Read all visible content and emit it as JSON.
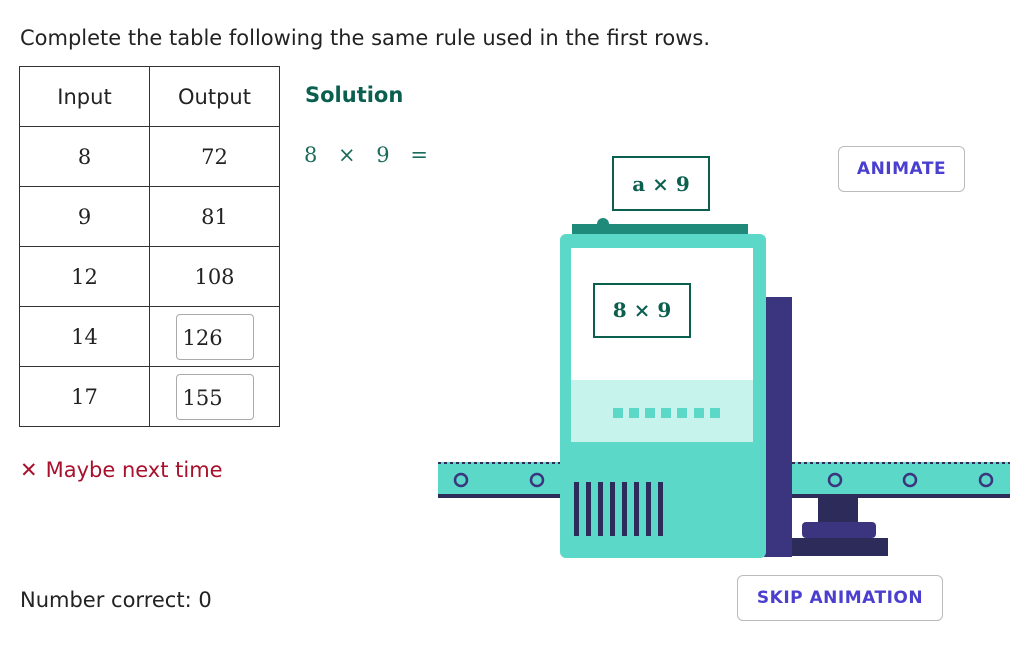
{
  "instruction": "Complete the table following the same rule used in the first rows.",
  "table": {
    "headers": [
      "Input",
      "Output"
    ],
    "rows": [
      {
        "input": "8",
        "output": "72"
      },
      {
        "input": "9",
        "output": "81"
      },
      {
        "input": "12",
        "output": "108"
      },
      {
        "input": "14",
        "output": "126"
      },
      {
        "input": "17",
        "output": "155"
      }
    ]
  },
  "feedback": {
    "icon": "close-icon",
    "text": "Maybe next time",
    "color": "#a8102c"
  },
  "score_text": "Number correct: 0",
  "solution": {
    "title": "Solution",
    "equation": "8 × 9 ="
  },
  "machine": {
    "rule_label": "a × 9",
    "screen_label": "8 × 9",
    "colors": {
      "body": "#5bd8c8",
      "dark": "#3b3580",
      "accent": "#1f8a7a"
    }
  },
  "buttons": {
    "animate": "ANIMATE",
    "skip": "SKIP ANIMATION"
  }
}
